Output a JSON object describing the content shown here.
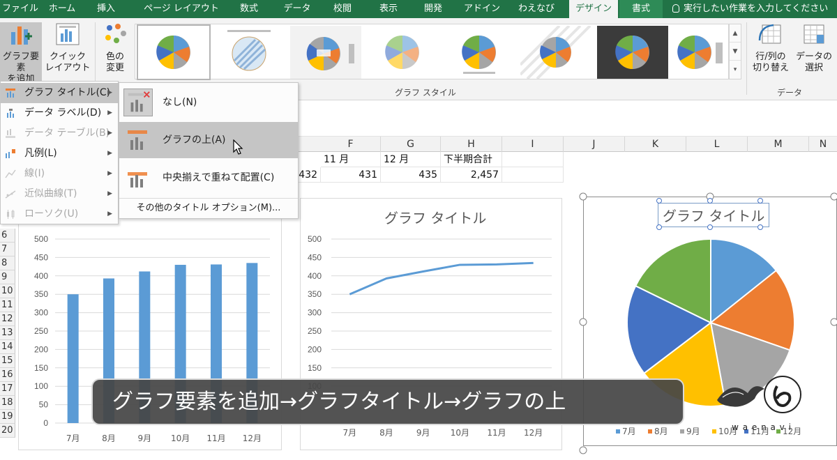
{
  "ribbon_tabs": [
    "ファイル",
    "ホーム",
    "挿入",
    "ページ レイアウト",
    "数式",
    "データ",
    "校閲",
    "表示",
    "開発",
    "アドイン",
    "わえなび",
    "デザイン",
    "書式"
  ],
  "tell_me": "実行したい作業を入力してください",
  "ribbon": {
    "add_element_label": "グラフ要素\nを追加",
    "quick_layout_label": "クイック\nレイアウト",
    "change_color_label": "色の\n変更",
    "styles_group": "グラフ スタイル",
    "switch_row_col_label": "行/列の\n切り替え",
    "select_data_label": "データの\n選択",
    "data_group": "データ"
  },
  "menu_level1": [
    {
      "label": "グラフ タイトル(C)",
      "disabled": false,
      "hover": true
    },
    {
      "label": "データ ラベル(D)",
      "disabled": false,
      "hover": false
    },
    {
      "label": "データ テーブル(B)",
      "disabled": true,
      "hover": false
    },
    {
      "label": "凡例(L)",
      "disabled": false,
      "hover": false
    },
    {
      "label": "線(I)",
      "disabled": true,
      "hover": false
    },
    {
      "label": "近似曲線(T)",
      "disabled": true,
      "hover": false
    },
    {
      "label": "ローソク(U)",
      "disabled": true,
      "hover": false
    }
  ],
  "menu_level2": {
    "items": [
      {
        "label": "なし(N)",
        "hover": false
      },
      {
        "label": "グラフの上(A)",
        "hover": true
      },
      {
        "label": "中央揃えで重ねて配置(C)",
        "hover": false
      }
    ],
    "more": "その他のタイトル オプション(M)..."
  },
  "sheet": {
    "columns": [
      "F",
      "G",
      "H",
      "I",
      "J",
      "K",
      "L",
      "M",
      "N"
    ],
    "header_row": [
      "11 月",
      "12 月",
      "下半期合計"
    ],
    "values_row": [
      "432",
      "431",
      "435",
      "2,457"
    ],
    "row_numbers": [
      "6",
      "7",
      "8",
      "9",
      "10",
      "11",
      "12",
      "13",
      "14",
      "15",
      "16",
      "17",
      "18",
      "19",
      "20"
    ]
  },
  "chart_data": [
    {
      "type": "bar",
      "categories": [
        "7月",
        "8月",
        "9月",
        "10月",
        "11月",
        "12月"
      ],
      "values": [
        350,
        393,
        412,
        430,
        431,
        435
      ],
      "ylim": [
        0,
        500
      ],
      "yticks": [
        "0",
        "50",
        "100",
        "150",
        "200",
        "250",
        "300",
        "350",
        "400",
        "450",
        "500"
      ],
      "color": "#5b9bd5"
    },
    {
      "type": "line",
      "title": "グラフ タイトル",
      "categories": [
        "7月",
        "8月",
        "9月",
        "10月",
        "11月",
        "12月"
      ],
      "values": [
        350,
        393,
        412,
        430,
        431,
        435
      ],
      "ylim": [
        0,
        500
      ],
      "yticks": [
        "100",
        "150",
        "200",
        "250",
        "300",
        "350",
        "400",
        "450",
        "500"
      ],
      "color": "#5b9bd5"
    },
    {
      "type": "pie",
      "title": "グラフ タイトル",
      "categories": [
        "7月",
        "8月",
        "9月",
        "10月",
        "11月",
        "12月"
      ],
      "values": [
        350,
        393,
        412,
        430,
        431,
        435
      ],
      "colors": [
        "#5b9bd5",
        "#ed7d31",
        "#a5a5a5",
        "#ffc000",
        "#4472c4",
        "#70ad47"
      ],
      "legend": "bottom"
    }
  ],
  "caption": "グラフ要素を追加→グラフタイトル→グラフの上",
  "logo_text": "w a e n a v i"
}
